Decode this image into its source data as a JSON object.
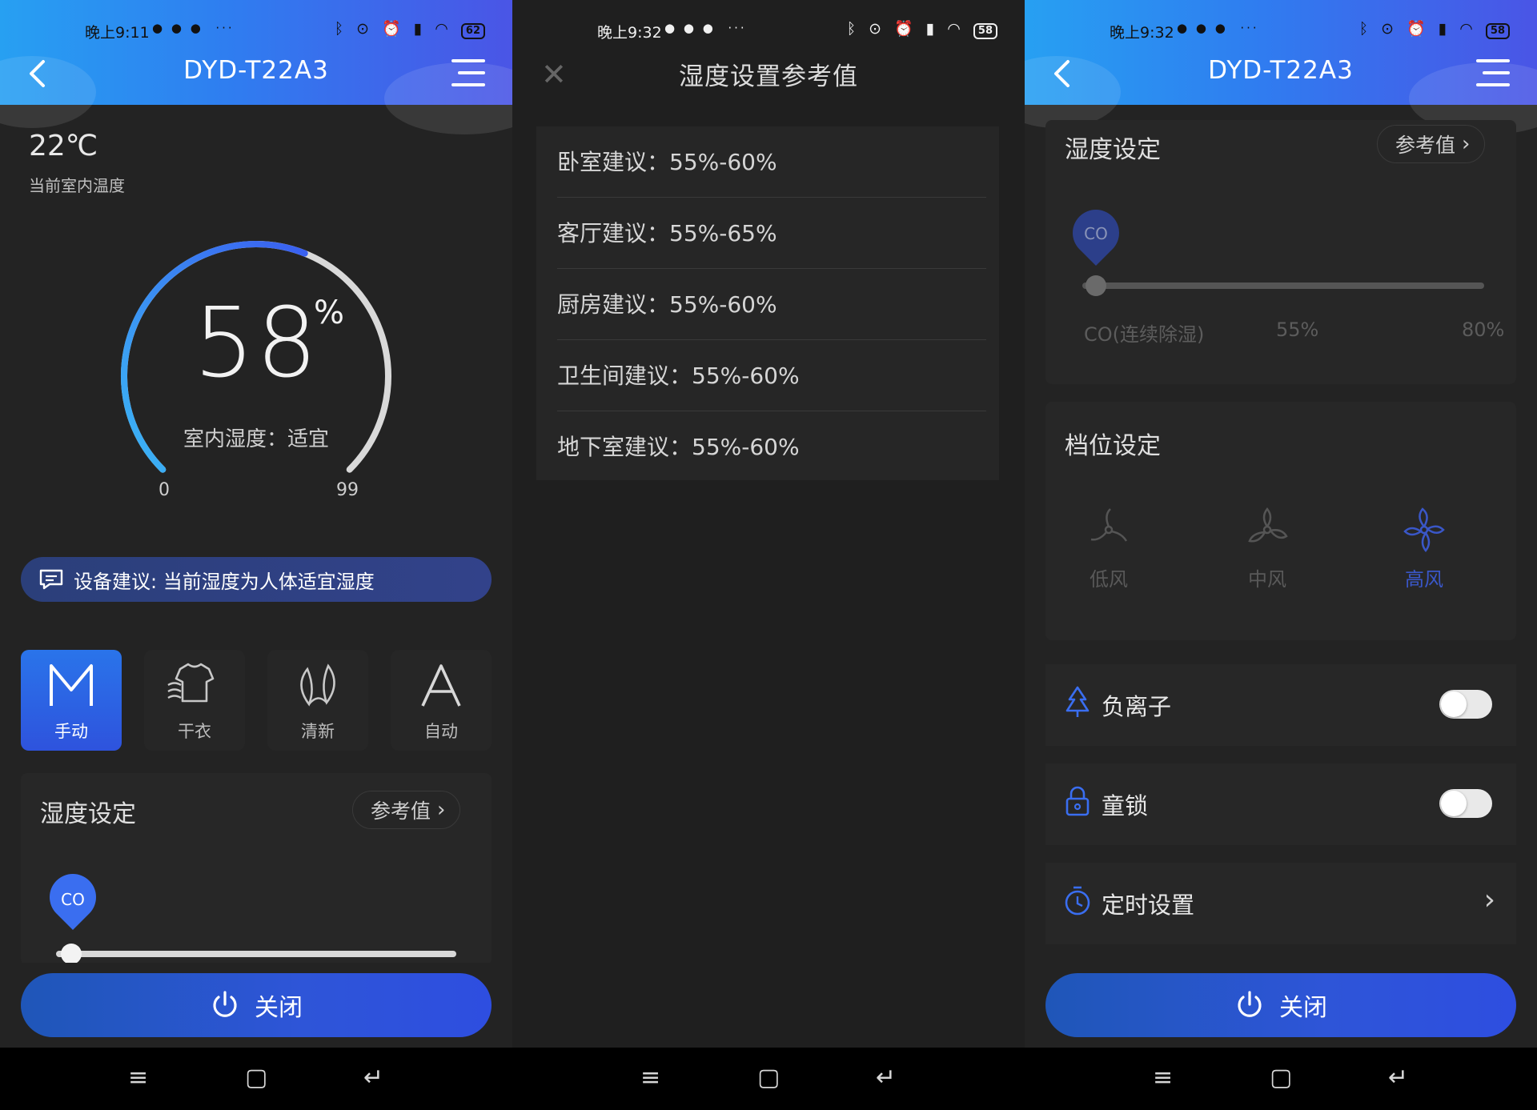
{
  "colors": {
    "accent": "#2e55d8",
    "header_start": "#27a0f2",
    "header_end": "#4a55e6",
    "bg": "#232323"
  },
  "panel_main": {
    "status": {
      "time": "晚上9:11",
      "more": "···",
      "battery": "62"
    },
    "title": "DYD-T22A3",
    "temperature": "22℃",
    "temperature_label": "当前室内温度",
    "humidity_value": "58",
    "humidity_unit": "%",
    "humidity_state": "室内湿度：适宜",
    "gauge_min": "0",
    "gauge_max": "99",
    "gauge_fraction": 0.58,
    "advice": "设备建议: 当前湿度为人体适宜湿度",
    "modes": [
      {
        "label": "手动",
        "icon": "manual-M-icon",
        "active": true
      },
      {
        "label": "干衣",
        "icon": "dry-clothes-icon",
        "active": false
      },
      {
        "label": "清新",
        "icon": "fresh-leaf-icon",
        "active": false
      },
      {
        "label": "自动",
        "icon": "auto-A-icon",
        "active": false
      }
    ],
    "humidity_section_title": "湿度设定",
    "ref_button": "参考值",
    "slider_badge": "CO",
    "power_label": "关闭"
  },
  "panel_reference": {
    "status": {
      "time": "晚上9:32",
      "more": "···",
      "battery": "58"
    },
    "title": "湿度设置参考值",
    "rows": [
      "卧室建议：55%-60%",
      "客厅建议：55%-65%",
      "厨房建议：55%-60%",
      "卫生间建议：55%-60%",
      "地下室建议：55%-60%"
    ]
  },
  "panel_settings": {
    "status": {
      "time": "晚上9:32",
      "more": "···",
      "battery": "58"
    },
    "title": "DYD-T22A3",
    "humidity_section_title": "湿度设定",
    "ref_button": "参考值",
    "slider_badge": "CO",
    "slider_labels": [
      "CO(连续除湿)",
      "55%",
      "80%"
    ],
    "fan_section_title": "档位设定",
    "fan_speeds": [
      {
        "label": "低风",
        "selected": false
      },
      {
        "label": "中风",
        "selected": false
      },
      {
        "label": "高风",
        "selected": true
      }
    ],
    "anion_label": "负离子",
    "anion_on": false,
    "child_lock_label": "童锁",
    "child_lock_on": false,
    "timer_label": "定时设置",
    "power_label": "关闭"
  }
}
